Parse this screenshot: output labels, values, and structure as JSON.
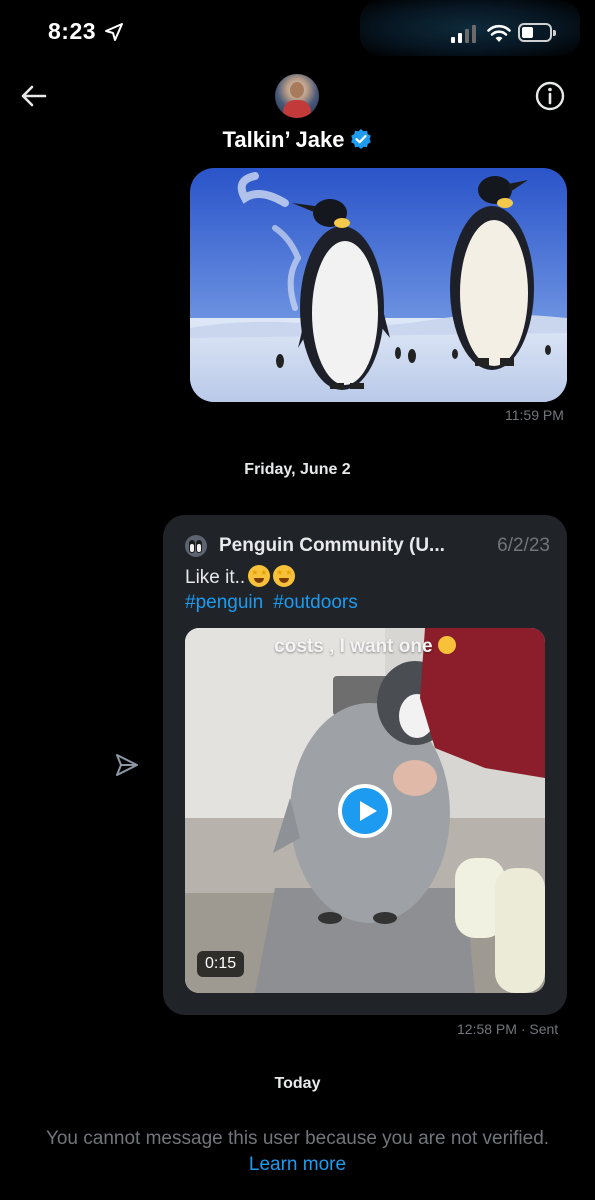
{
  "status_bar": {
    "time": "8:23"
  },
  "header": {
    "contact_name": "Talkin’ Jake"
  },
  "messages": [
    {
      "type": "image",
      "timestamp": "11:59 PM"
    },
    {
      "type": "date_separator",
      "label": "Friday, June 2"
    },
    {
      "type": "shared_post",
      "author": "Penguin Community (U...",
      "date": "6/2/23",
      "text": "Like it..",
      "hashtags": [
        "#penguin",
        "#outdoors"
      ],
      "video_caption": "costs , I want one",
      "duration": "0:15",
      "timestamp": "12:58 PM",
      "status": "· Sent"
    },
    {
      "type": "date_separator",
      "label": "Today"
    }
  ],
  "footer": {
    "notice": "You cannot message this user because you are not verified.",
    "link": "Learn more"
  },
  "colors": {
    "accent": "#1d9bf0",
    "background": "#000000",
    "card": "#202327",
    "muted": "#71767b"
  }
}
